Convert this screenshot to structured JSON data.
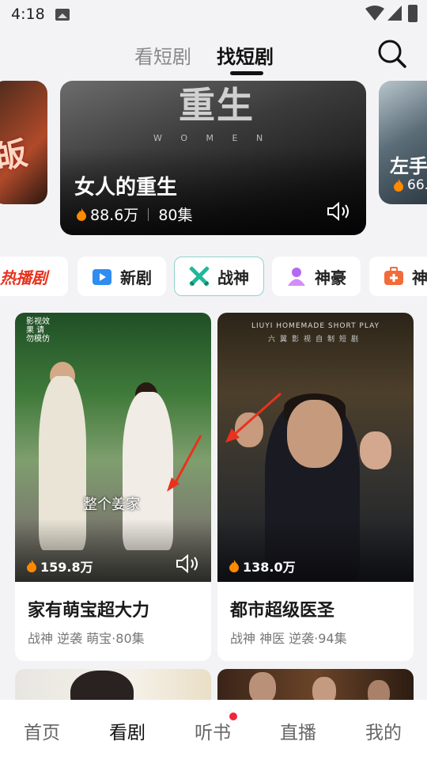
{
  "status_bar": {
    "time": "4:18"
  },
  "top_tabs": {
    "tabs": [
      {
        "label": "看短剧"
      },
      {
        "label": "找短剧"
      }
    ],
    "active_index": 1
  },
  "banner": {
    "main": {
      "title": "女人的重生",
      "views": "88.6万",
      "episodes": "80集",
      "poster_text": "重生",
      "poster_sub": "W O M E N"
    },
    "left": {
      "poster_text": "皈"
    },
    "right": {
      "title": "左手",
      "views": "66."
    }
  },
  "chips": [
    {
      "label": "热播剧"
    },
    {
      "label": "新剧"
    },
    {
      "label": "战神"
    },
    {
      "label": "神豪"
    },
    {
      "label": "神"
    }
  ],
  "selected_chip": "战神",
  "cards": [
    {
      "title": "家有萌宝超大力",
      "tags": "战神 逆袭 萌宝·80集",
      "views": "159.8万",
      "poster_caption": "整个姜家",
      "poster_vertical": "影视效果 请勿模仿"
    },
    {
      "title": "都市超级医圣",
      "tags": "战神 神医 逆袭·94集",
      "views": "138.0万",
      "poster_top_en": "LIUYI HOMEMADE SHORT PLAY",
      "poster_top_cn": "六翼影视自制短剧"
    }
  ],
  "bottom_nav": {
    "items": [
      {
        "label": "首页"
      },
      {
        "label": "看剧"
      },
      {
        "label": "听书"
      },
      {
        "label": "直播"
      },
      {
        "label": "我的"
      }
    ],
    "active_index": 1
  },
  "colors": {
    "accent_hot": "#e8321e",
    "chip_selected_border": "#8fd3cc",
    "notification_dot": "#f0263a",
    "flame": "#ff8a00"
  }
}
